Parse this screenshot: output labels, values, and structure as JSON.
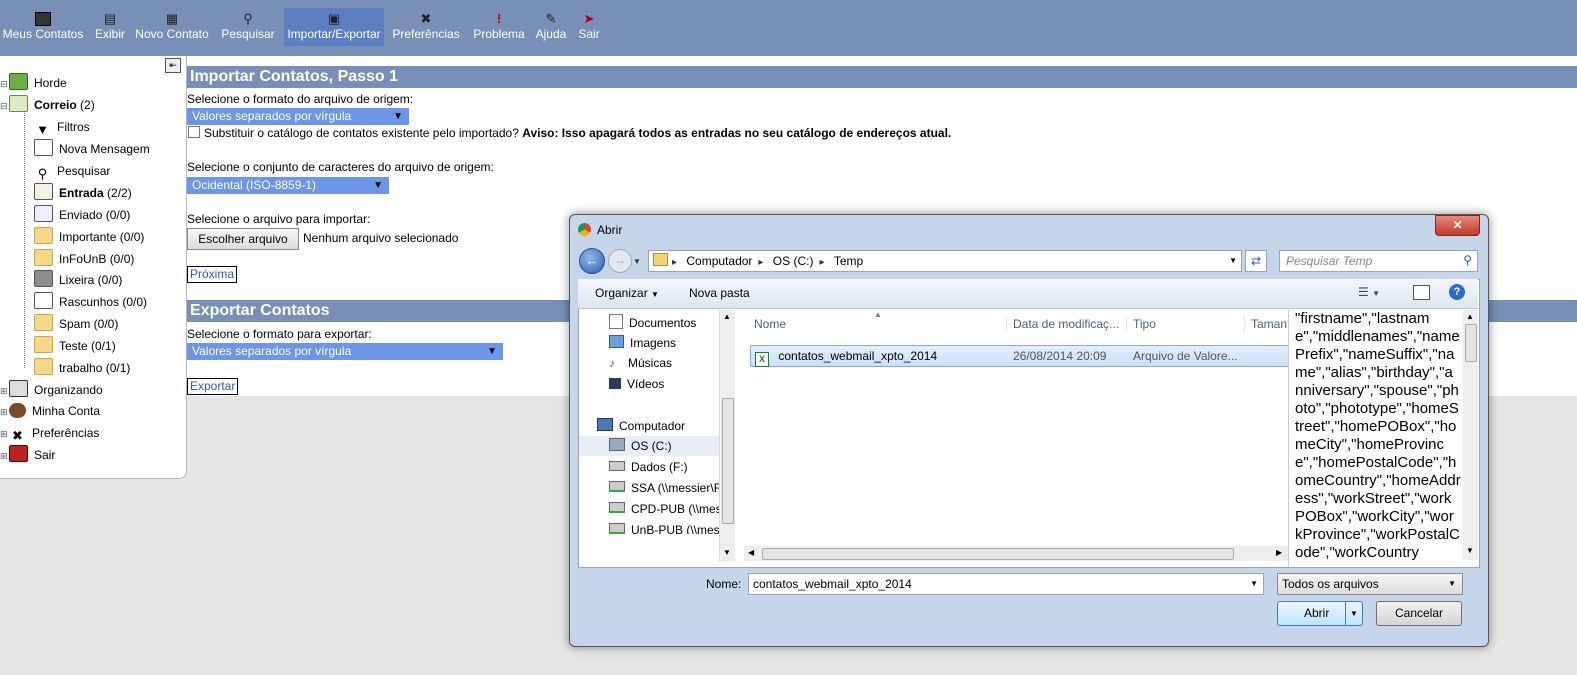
{
  "toolbar": {
    "items": [
      {
        "label": "Meus Contatos"
      },
      {
        "label": "Exibir"
      },
      {
        "label": "Novo Contato"
      },
      {
        "label": "Pesquisar"
      },
      {
        "label": "Importar/Exportar"
      },
      {
        "label": "Preferências"
      },
      {
        "label": "Problema"
      },
      {
        "label": "Ajuda"
      },
      {
        "label": "Sair"
      }
    ]
  },
  "sidebar": {
    "items": [
      {
        "label": "Horde"
      },
      {
        "label": "Correio",
        "count": "(2)"
      },
      {
        "label": "Filtros"
      },
      {
        "label": "Nova Mensagem"
      },
      {
        "label": "Pesquisar"
      },
      {
        "label": "Entrada",
        "count": "(2/2)"
      },
      {
        "label": "Enviado (0/0)"
      },
      {
        "label": "Importante (0/0)"
      },
      {
        "label": "InFoUnB (0/0)"
      },
      {
        "label": "Lixeira (0/0)"
      },
      {
        "label": "Rascunhos (0/0)"
      },
      {
        "label": "Spam (0/0)"
      },
      {
        "label": "Teste (0/1)"
      },
      {
        "label": "trabalho (0/1)"
      },
      {
        "label": "Organizando"
      },
      {
        "label": "Minha Conta"
      },
      {
        "label": "Preferências"
      },
      {
        "label": "Sair"
      }
    ]
  },
  "import": {
    "title": "Importar Contatos, Passo 1",
    "format_label": "Selecione o formato do arquivo de origem:",
    "format_value": "Valores separados por vírgula",
    "replace_label": "Substituir o catálogo de contatos existente pelo importado?",
    "warning": "Aviso: Isso apagará todos as entradas no seu catálogo de endereços atual.",
    "charset_label": "Selecione o conjunto de caracteres do arquivo de origem:",
    "charset_value": "Ocidental (ISO-8859-1)",
    "file_label": "Selecione o arquivo para importar:",
    "choose_button": "Escolher arquivo",
    "no_file": "Nenhum arquivo selecionado",
    "next_button": "Próxima"
  },
  "export": {
    "title": "Exportar Contatos",
    "format_label": "Selecione o formato para exportar:",
    "format_value": "Valores separados por vírgula",
    "export_button": "Exportar"
  },
  "dialog": {
    "title": "Abrir",
    "breadcrumb": [
      "Computador",
      "OS (C:)",
      "Temp"
    ],
    "search_placeholder": "Pesquisar Temp",
    "organize": "Organizar",
    "new_folder": "Nova pasta",
    "nav_items": [
      {
        "label": "Documentos"
      },
      {
        "label": "Imagens"
      },
      {
        "label": "Músicas"
      },
      {
        "label": "Vídeos"
      },
      {
        "label": "Computador"
      },
      {
        "label": "OS (C:)"
      },
      {
        "label": "Dados (F:)"
      },
      {
        "label": "SSA (\\\\messier\\F"
      },
      {
        "label": "CPD-PUB (\\\\mes"
      },
      {
        "label": "UnB-PUB (\\\\mes"
      }
    ],
    "columns": [
      "Nome",
      "Data de modificaç...",
      "Tipo",
      "Taman"
    ],
    "files": [
      {
        "name": "contatos_webmail_xpto_2014",
        "date": "26/08/2014 20:09",
        "type": "Arquivo de Valore..."
      }
    ],
    "preview_text": "\"firstname\",\"lastname\",\"middlenames\",\"namePrefix\",\"nameSuffix\",\"name\",\"alias\",\"birthday\",\"anniversary\",\"spouse\",\"photo\",\"phototype\",\"homeStreet\",\"homePOBox\",\"homeCity\",\"homeProvince\",\"homePostalCode\",\"homeCountry\",\"homeAddress\",\"workStreet\",\"workPOBox\",\"workCity\",\"workProvince\",\"workPostalCode\",\"workCountry",
    "name_label": "Nome:",
    "name_value": "contatos_webmail_xpto_2014",
    "filter_value": "Todos os arquivos",
    "open_button": "Abrir",
    "cancel_button": "Cancelar"
  }
}
